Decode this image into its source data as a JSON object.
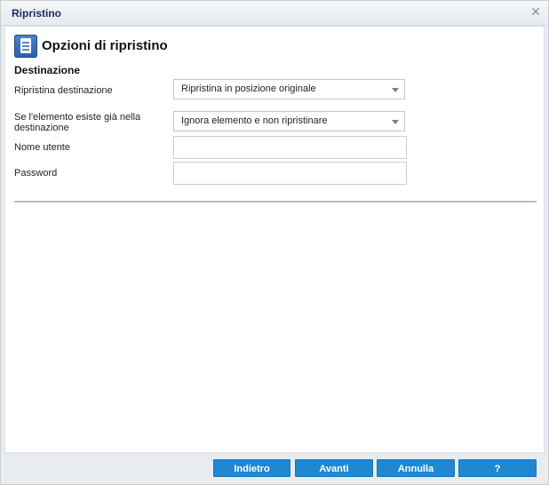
{
  "window": {
    "title": "Ripristino",
    "close_symbol": "✕"
  },
  "header": {
    "title": "Opzioni di ripristino",
    "icon": "document-list-icon"
  },
  "section": {
    "title": "Destinazione"
  },
  "form": {
    "restore_destination": {
      "label": "Ripristina destinazione",
      "value": "Ripristina in posizione originale"
    },
    "if_exists": {
      "label_line1": "Se l'elemento esiste già nella",
      "label_line2": "destinazione",
      "value": "Ignora elemento e non ripristinare"
    },
    "username": {
      "label": "Nome utente",
      "value": ""
    },
    "password": {
      "label": "Password",
      "value": ""
    }
  },
  "buttons": {
    "back": "Indietro",
    "next": "Avanti",
    "cancel": "Annulla",
    "help": "?"
  },
  "colors": {
    "button_bg": "#1f88d0",
    "title_text": "#1a2a5e"
  }
}
